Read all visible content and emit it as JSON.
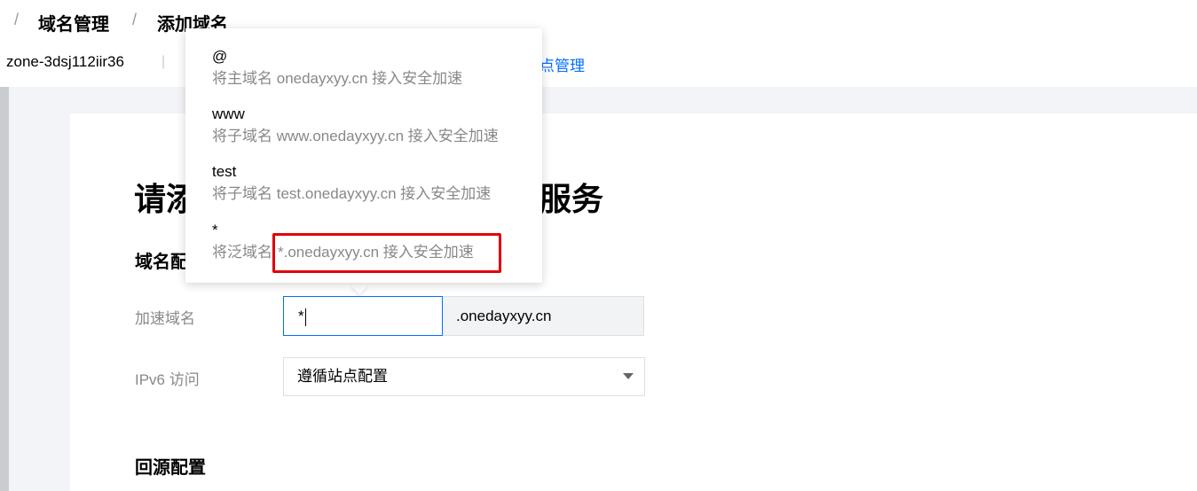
{
  "breadcrumb": {
    "separator": "/",
    "items": [
      "域名管理",
      "添加域名"
    ]
  },
  "zone": {
    "id": "zone-3dsj112iir36",
    "divider": "|",
    "site_link": "点管理"
  },
  "page": {
    "heading_left": "请添",
    "heading_right": "服务",
    "section_domain": "域名配",
    "section_origin": "回源配置"
  },
  "form": {
    "accel_domain_label": "加速域名",
    "accel_domain_value": "*",
    "domain_suffix": ".onedayxyy.cn",
    "ipv6_label": "IPv6 访问",
    "ipv6_value": "遵循站点配置"
  },
  "dropdown": {
    "options": [
      {
        "value": "@",
        "desc_prefix": "将主域名",
        "desc_domain": "onedayxyy.cn",
        "desc_suffix": "接入安全加速"
      },
      {
        "value": "www",
        "desc_prefix": "将子域名",
        "desc_domain": "www.onedayxyy.cn",
        "desc_suffix": "接入安全加速"
      },
      {
        "value": "test",
        "desc_prefix": "将子域名",
        "desc_domain": "test.onedayxyy.cn",
        "desc_suffix": "接入安全加速"
      },
      {
        "value": "*",
        "desc_prefix": "将泛域名",
        "desc_domain": "*.onedayxyy.cn",
        "desc_suffix": "接入安全加速"
      }
    ]
  },
  "colors": {
    "accent": "#006eff",
    "highlight": "#e0000a",
    "muted": "#888888"
  }
}
